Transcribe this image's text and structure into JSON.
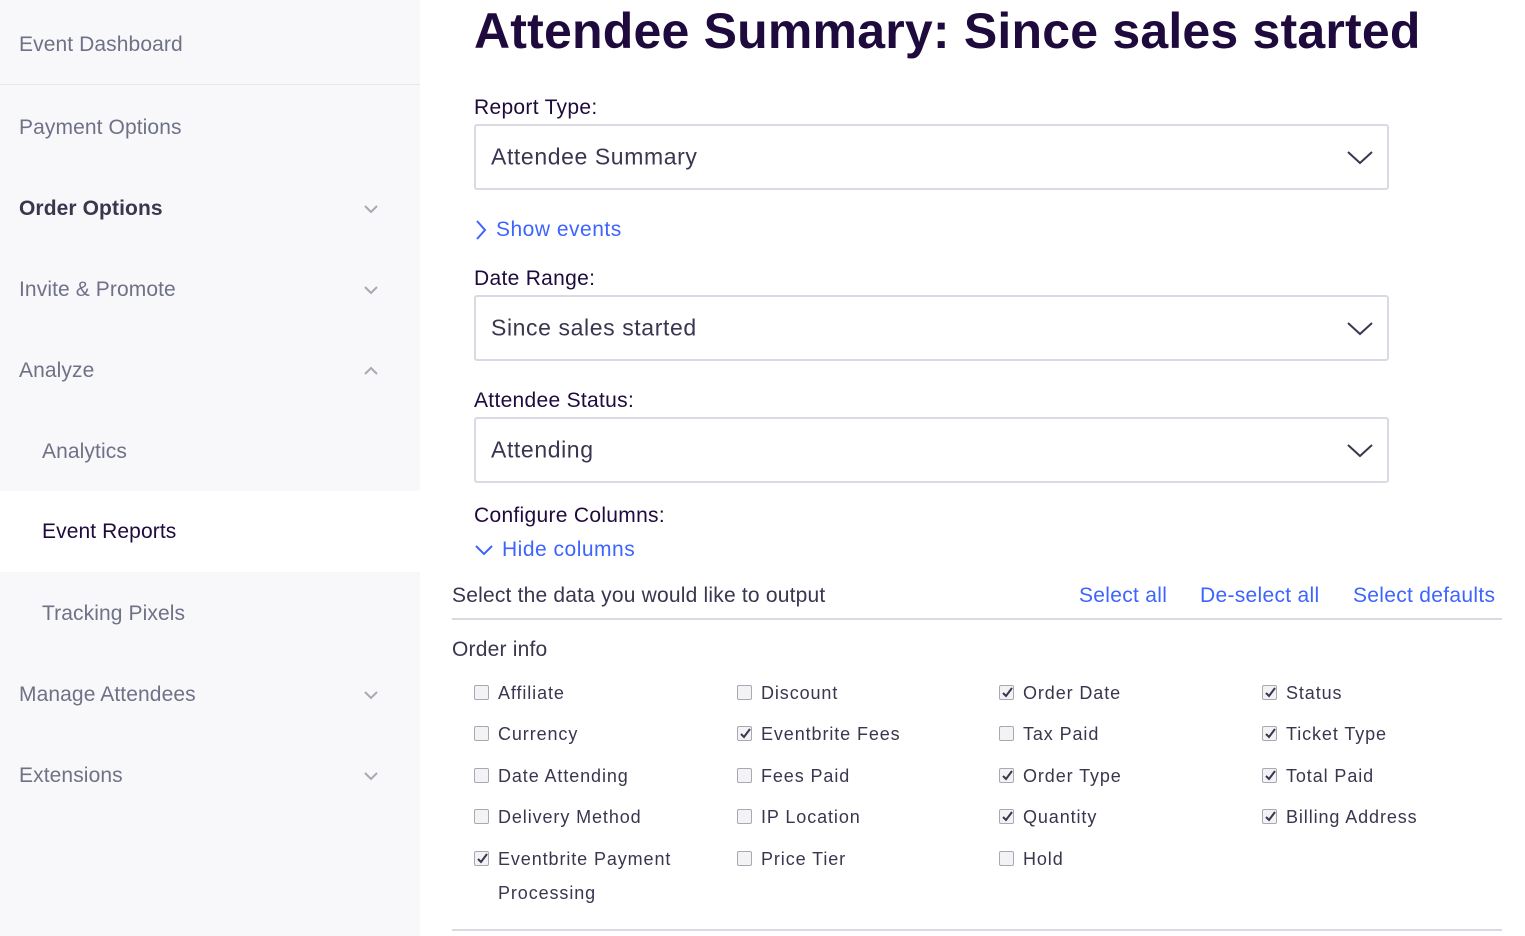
{
  "sidebar": {
    "items": [
      {
        "label": "Event Dashboard",
        "chevron": "none"
      },
      {
        "label": "Payment Options",
        "chevron": "none"
      },
      {
        "label": "Order Options",
        "chevron": "down"
      },
      {
        "label": "Invite & Promote",
        "chevron": "down"
      },
      {
        "label": "Analyze",
        "chevron": "up"
      },
      {
        "label": "Analytics",
        "chevron": "none"
      },
      {
        "label": "Event Reports",
        "chevron": "none",
        "active": true
      },
      {
        "label": "Tracking Pixels",
        "chevron": "none"
      },
      {
        "label": "Manage Attendees",
        "chevron": "down"
      },
      {
        "label": "Extensions",
        "chevron": "down"
      }
    ]
  },
  "main": {
    "title": "Attendee Summary: Since sales started",
    "report_type": {
      "label": "Report Type:",
      "value": "Attendee Summary"
    },
    "show_events": "Show events",
    "date_range": {
      "label": "Date Range:",
      "value": "Since sales started"
    },
    "attendee_status": {
      "label": "Attendee Status:",
      "value": "Attending"
    },
    "configure_columns": {
      "label": "Configure Columns:",
      "hide_link": "Hide columns"
    },
    "output": {
      "text": "Select the data you would like to output",
      "select_all": "Select all",
      "deselect_all": "De-select all",
      "select_defaults": "Select defaults"
    },
    "order_info": {
      "title": "Order info",
      "columns": [
        [
          {
            "label": "Affiliate",
            "checked": false
          },
          {
            "label": "Currency",
            "checked": false
          },
          {
            "label": "Date Attending",
            "checked": false
          },
          {
            "label": "Delivery Method",
            "checked": false
          },
          {
            "label": "Eventbrite Payment Processing",
            "checked": true
          }
        ],
        [
          {
            "label": "Discount",
            "checked": false
          },
          {
            "label": "Eventbrite Fees",
            "checked": true
          },
          {
            "label": "Fees Paid",
            "checked": false
          },
          {
            "label": "IP Location",
            "checked": false
          },
          {
            "label": "Price Tier",
            "checked": false
          }
        ],
        [
          {
            "label": "Order Date",
            "checked": true
          },
          {
            "label": "Tax Paid",
            "checked": false
          },
          {
            "label": "Order Type",
            "checked": true
          },
          {
            "label": "Quantity",
            "checked": true
          },
          {
            "label": "Hold",
            "checked": false
          }
        ],
        [
          {
            "label": "Status",
            "checked": true
          },
          {
            "label": "Ticket Type",
            "checked": true
          },
          {
            "label": "Total Paid",
            "checked": true
          },
          {
            "label": "Billing Address",
            "checked": true
          }
        ]
      ]
    }
  },
  "colors": {
    "accent": "#3d64ff",
    "title": "#1e0a3c",
    "sidebar_bg": "#f8f7fa"
  }
}
